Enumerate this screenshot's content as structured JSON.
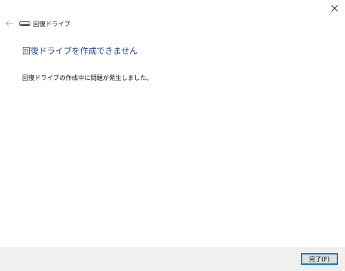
{
  "window": {
    "app_title": "回復ドライブ"
  },
  "content": {
    "heading": "回復ドライブを作成できません",
    "message": "回復ドライブの作成中に問題が発生しました。"
  },
  "footer": {
    "finish_label": "完了(F)"
  },
  "icons": {
    "back": "back-arrow-icon",
    "drive": "drive-icon",
    "close": "close-icon"
  },
  "colors": {
    "heading": "#1d3f91",
    "accent": "#0078d7",
    "footer_bg": "#f0f0f0"
  }
}
